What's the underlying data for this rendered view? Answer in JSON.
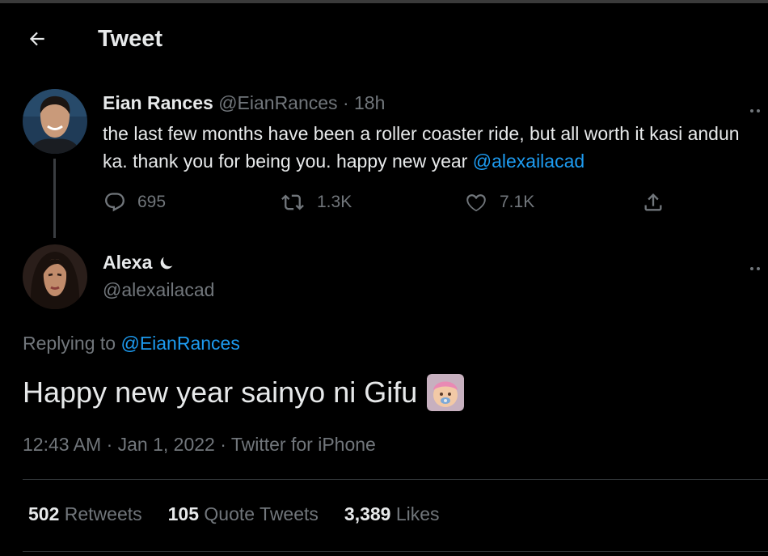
{
  "header": {
    "title": "Tweet"
  },
  "parent_tweet": {
    "author_name": "Eian Rances",
    "handle": "@EianRances",
    "separator": "·",
    "time": "18h",
    "text": "the last few months have been a roller coaster ride, but all worth it kasi andun ka. thank you for being you. happy new year ",
    "mention": "@alexailacad",
    "replies": "695",
    "retweets": "1.3K",
    "likes": "7.1K"
  },
  "reply_tweet": {
    "author_name": "Alexa",
    "handle": "@alexailacad",
    "replying_prefix": "Replying to ",
    "replying_to": "@EianRances",
    "text": "Happy new year sainyo ni Gifu",
    "meta": "12:43 AM · Jan 1, 2022 · Twitter for iPhone"
  },
  "stats": {
    "retweets_count": "502",
    "retweets_label": "Retweets",
    "quotes_count": "105",
    "quotes_label": "Quote Tweets",
    "likes_count": "3,389",
    "likes_label": "Likes"
  },
  "icons": {
    "back": "arrow-left-icon",
    "reply": "reply-icon",
    "retweet": "retweet-icon",
    "like": "heart-icon",
    "share": "share-icon",
    "more": "more-icon",
    "moon": "moon-icon",
    "emoji": "baby-emoji-icon"
  },
  "colors": {
    "background": "#000000",
    "text": "#e7e9ea",
    "muted": "#71767b",
    "link": "#1d9bf0"
  }
}
